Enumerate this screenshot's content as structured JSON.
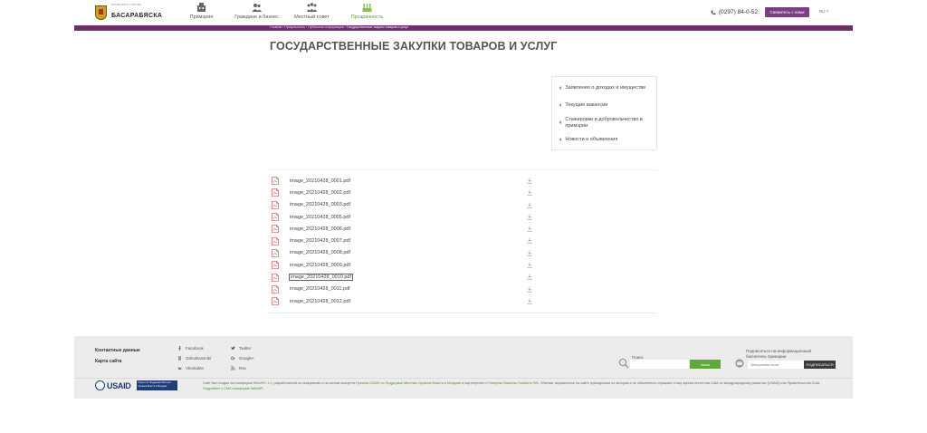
{
  "header": {
    "logo_sub": "ПРИМЭРИЯ ГОРОДА",
    "logo_name": "БАСАРАБЯСКА",
    "nav": [
      {
        "label": "Примэрия",
        "icon": "building-icon",
        "active": false
      },
      {
        "label": "Граждане и бизнес",
        "icon": "people-icon",
        "active": false
      },
      {
        "label": "Местный совет",
        "icon": "council-icon",
        "active": false
      },
      {
        "label": "Прозрачность",
        "icon": "transparency-icon",
        "active": true
      }
    ],
    "phone": "(0297) 84-0-52",
    "contact_button": "Свяжитесь с нами",
    "lang": "RU"
  },
  "breadcrumb": {
    "path": "Главная › Прозрачность › Публичная информация ›",
    "current": "Государственные закупки товаров и услуг"
  },
  "page_title": "ГОСУДАРСТВЕННЫЕ ЗАКУПКИ ТОВАРОВ И УСЛУГ",
  "side_menu": [
    "Заявления о доходах и имуществе",
    "Текущие вакансии",
    "Стажировки и добровольчество в примэрии",
    "Новости и объявления"
  ],
  "files": [
    "image_20210428_0001.pdf",
    "image_20210428_0002.pdf",
    "image_20210428_0003.pdf",
    "image_20210428_0005.pdf",
    "image_20210428_0006.pdf",
    "image_20210428_0007.pdf",
    "image_20210428_0008.pdf",
    "image_20210428_0009.pdf",
    "image_20210428_0010.pdf",
    "image_20210428_0011.pdf",
    "image_20210428_0012.pdf"
  ],
  "focused_file_index": 8,
  "footer": {
    "links": [
      "Контактные данные",
      "Карта сайта"
    ],
    "social_left": [
      "Facebook",
      "Odnoklassniki",
      "Vkontakte"
    ],
    "social_right": [
      "Twitter",
      "Google+",
      "Rss"
    ],
    "search_label": "Поиск",
    "search_button": "поиск",
    "subscribe_label": "Подписаться на информационный бюллетень примэрии",
    "subscribe_placeholder": "Электронная почта",
    "subscribe_button": "ПОДПИСАТЬСЯ",
    "usaid_word": "USAID",
    "usaid_tag": "Проект по Поддержке Местных Органов Власти в Молдове",
    "disclaimer_1": "Сайт был создан на платформе ",
    "disclaimer_2": "WebAPL 1.0",
    "disclaimer_3": ", разработанной по инициативе и на основе концепта ",
    "disclaimer_4": "Проекта USAID по Поддержке Местных Органов Власти в Молдове",
    "disclaimer_5": " в партнерстве с ",
    "disclaimer_6": "Enterprise Business Solutions SRL",
    "disclaimer_7": ". Мнения, выраженные на сайте принадлежат их авторам и не обязательно отражают точку зрения Агентства США по международному развитию (USAID) или Правительства США. ",
    "disclaimer_8": "Подробнее о CMS платформе WebAPL"
  },
  "colors": {
    "brand_purple": "#6b2f6f",
    "accent_green": "#5fa83a",
    "pdf_red": "#c0392b"
  }
}
